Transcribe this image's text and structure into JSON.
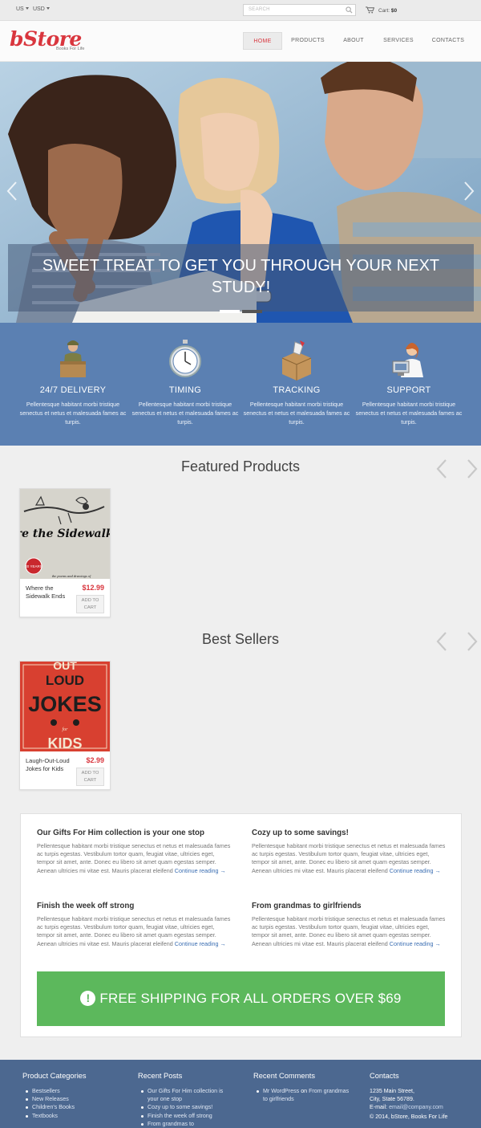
{
  "topbar": {
    "country": "US",
    "currency": "USD",
    "search_placeholder": "SEARCH",
    "cart_label": "Cart:",
    "cart_total": "$0"
  },
  "header": {
    "logo": "bStore",
    "tagline": "Books For Life",
    "nav": [
      "HOME",
      "PRODUCTS",
      "ABOUT",
      "SERVICES",
      "CONTACTS"
    ],
    "active_nav": "HOME"
  },
  "hero": {
    "caption_line1": "SWEET TREAT TO GET YOU THROUGH YOUR NEXT",
    "caption_line2": "STUDY!",
    "slide_count": 2,
    "active_slide": 1
  },
  "features": [
    {
      "title": "24/7 DELIVERY",
      "icon": "delivery-man-icon",
      "text": "Pellentesque habitant morbi tristique senectus et netus et malesuada fames ac turpis."
    },
    {
      "title": "TIMING",
      "icon": "stopwatch-icon",
      "text": "Pellentesque habitant morbi tristique senectus et netus et malesuada fames ac turpis."
    },
    {
      "title": "TRACKING",
      "icon": "package-icon",
      "text": "Pellentesque habitant morbi tristique senectus et netus et malesuada fames ac turpis."
    },
    {
      "title": "SUPPORT",
      "icon": "support-agent-icon",
      "text": "Pellentesque habitant morbi tristique senectus et netus et malesuada fames ac turpis."
    }
  ],
  "featured": {
    "title": "Featured Products",
    "products": [
      {
        "name": "Where the Sidewalk Ends",
        "price": "$12.99",
        "cta": "ADD TO CART",
        "cover_title": "Where the Sidewalk Ends",
        "cover_badge": "40 YEARS",
        "cover_sub": "the poems and drawings of"
      }
    ]
  },
  "bestsellers": {
    "title": "Best Sellers",
    "products": [
      {
        "name": "Laugh-Out-Loud Jokes for Kids",
        "price": "$2.99",
        "cta": "ADD TO CART",
        "cover_words": [
          "OUT",
          "LOUD",
          "JOKES",
          "for",
          "KIDS"
        ]
      }
    ]
  },
  "blog": {
    "posts": [
      {
        "title": "Our Gifts For Him collection is your one stop",
        "body": "Pellentesque habitant morbi tristique senectus et netus et malesuada fames ac turpis egestas. Vestibulum tortor quam, feugiat vitae, ultricies eget, tempor sit amet, ante. Donec eu libero sit amet quam egestas semper. Aenean ultricies mi vitae est. Mauris placerat eleifend",
        "link": "Continue reading →"
      },
      {
        "title": "Cozy up to some savings!",
        "body": "Pellentesque habitant morbi tristique senectus et netus et malesuada fames ac turpis egestas. Vestibulum tortor quam, feugiat vitae, ultricies eget, tempor sit amet, ante. Donec eu libero sit amet quam egestas semper. Aenean ultricies mi vitae est. Mauris placerat eleifend",
        "link": "Continue reading →"
      },
      {
        "title": "Finish the week off strong",
        "body": "Pellentesque habitant morbi tristique senectus et netus et malesuada fames ac turpis egestas. Vestibulum tortor quam, feugiat vitae, ultricies eget, tempor sit amet, ante. Donec eu libero sit amet quam egestas semper. Aenean ultricies mi vitae est. Mauris placerat eleifend",
        "link": "Continue reading →"
      },
      {
        "title": "From grandmas to girlfriends",
        "body": "Pellentesque habitant morbi tristique senectus et netus et malesuada fames ac turpis egestas. Vestibulum tortor quam, feugiat vitae, ultricies eget, tempor sit amet, ante. Donec eu libero sit amet quam egestas semper. Aenean ultricies mi vitae est. Mauris placerat eleifend",
        "link": "Continue reading →"
      }
    ],
    "shipping_banner": "FREE SHIPPING FOR ALL ORDERS OVER $69",
    "shipping_icon": "!"
  },
  "footer": {
    "categories": {
      "title": "Product Categories",
      "items": [
        "Bestsellers",
        "New Releases",
        "Children's Books",
        "Textbooks"
      ]
    },
    "recent_posts": {
      "title": "Recent Posts",
      "items": [
        "Our Gifts For Him collection is your one stop",
        "Cozy up to some savings!",
        "Finish the week off strong",
        "From grandmas to"
      ]
    },
    "recent_comments": {
      "title": "Recent Comments",
      "author": "Mr WordPress",
      "on": "on",
      "target": "From grandmas to girlfriends"
    },
    "contacts": {
      "title": "Contacts",
      "street": "1235 Main Street,",
      "city": "City, State 56789.",
      "email_label": "E-mail:",
      "email": "email@company.com",
      "copyright": "© 2014, bStore, Books For Life"
    }
  },
  "colors": {
    "brand_red": "#d9363e",
    "feature_blue": "#5b80b2",
    "footer_blue": "#4c6890",
    "shipping_green": "#5cb85c",
    "link_blue": "#3b6eb2"
  }
}
